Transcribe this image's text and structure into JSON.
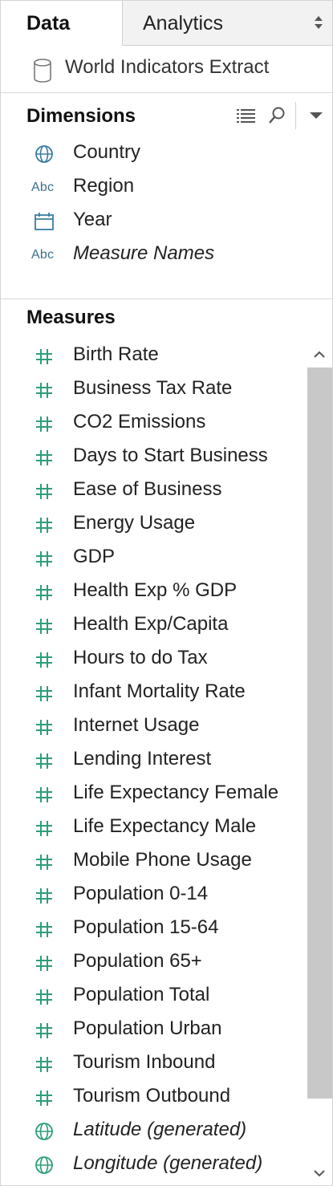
{
  "tabs": {
    "data": "Data",
    "analytics": "Analytics"
  },
  "datasource": {
    "name": "World Indicators Extract",
    "icon": "database-icon"
  },
  "dimensions": {
    "title": "Dimensions",
    "items": [
      {
        "label": "Country",
        "icon": "globe-icon",
        "italic": false
      },
      {
        "label": "Region",
        "icon": "abc-icon",
        "icon_text": "Abc",
        "italic": false
      },
      {
        "label": "Year",
        "icon": "calendar-icon",
        "italic": false
      },
      {
        "label": "Measure Names",
        "icon": "abc-icon",
        "icon_text": "Abc",
        "italic": true
      }
    ]
  },
  "measures": {
    "title": "Measures",
    "items": [
      {
        "label": "Birth Rate",
        "icon": "hash-icon"
      },
      {
        "label": "Business Tax Rate",
        "icon": "hash-icon"
      },
      {
        "label": "CO2 Emissions",
        "icon": "hash-icon"
      },
      {
        "label": "Days to Start Business",
        "icon": "hash-icon"
      },
      {
        "label": "Ease of Business",
        "icon": "hash-icon"
      },
      {
        "label": "Energy Usage",
        "icon": "hash-icon"
      },
      {
        "label": "GDP",
        "icon": "hash-icon"
      },
      {
        "label": "Health Exp % GDP",
        "icon": "hash-icon"
      },
      {
        "label": "Health Exp/Capita",
        "icon": "hash-icon"
      },
      {
        "label": "Hours to do Tax",
        "icon": "hash-icon"
      },
      {
        "label": "Infant Mortality Rate",
        "icon": "hash-icon"
      },
      {
        "label": "Internet Usage",
        "icon": "hash-icon"
      },
      {
        "label": "Lending Interest",
        "icon": "hash-icon"
      },
      {
        "label": "Life Expectancy Female",
        "icon": "hash-icon"
      },
      {
        "label": "Life Expectancy Male",
        "icon": "hash-icon"
      },
      {
        "label": "Mobile Phone Usage",
        "icon": "hash-icon"
      },
      {
        "label": "Population 0-14",
        "icon": "hash-icon"
      },
      {
        "label": "Population 15-64",
        "icon": "hash-icon"
      },
      {
        "label": "Population 65+",
        "icon": "hash-icon"
      },
      {
        "label": "Population Total",
        "icon": "hash-icon"
      },
      {
        "label": "Population Urban",
        "icon": "hash-icon"
      },
      {
        "label": "Tourism Inbound",
        "icon": "hash-icon"
      },
      {
        "label": "Tourism Outbound",
        "icon": "hash-icon"
      },
      {
        "label": "Latitude (generated)",
        "icon": "globe-icon",
        "italic": true
      },
      {
        "label": "Longitude (generated)",
        "icon": "globe-icon",
        "italic": true
      }
    ]
  },
  "colors": {
    "dimension": "#3b7ea1",
    "measure": "#2e9e78",
    "scroll_thumb": "#c8c8c8"
  }
}
